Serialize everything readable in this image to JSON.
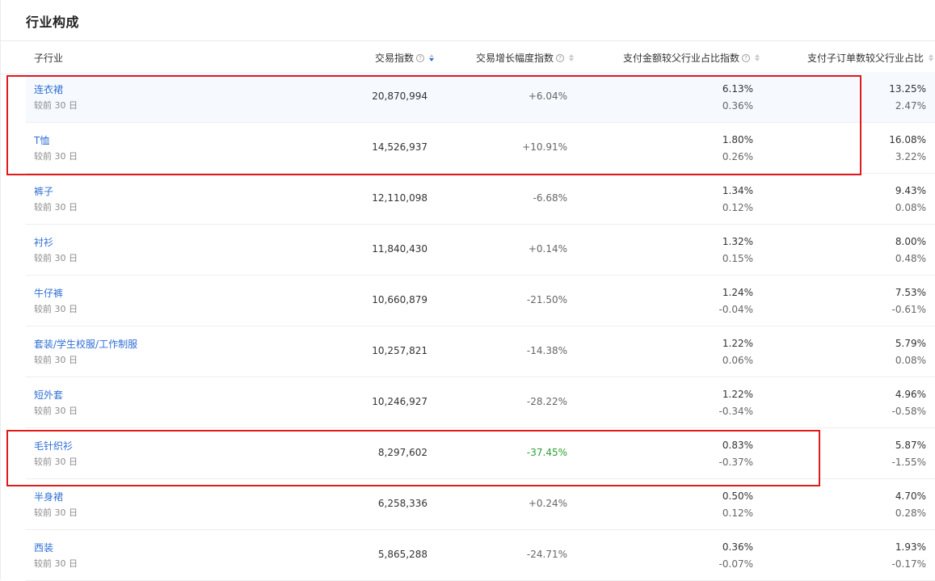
{
  "title": "行业构成",
  "headers": {
    "sub_industry": "子行业",
    "trade_index": "交易指数",
    "growth_index": "交易增长幅度指数",
    "pay_share": "支付金额较父行业占比指数",
    "order_share": "支付子订单数较父行业占比"
  },
  "compare_label": "较前 30 日",
  "rows": [
    {
      "name": "连衣裙",
      "compare": "较前 30 日",
      "trade": "20,870,994",
      "growth": "+6.04%",
      "pay": "6.13%",
      "pay_change": "0.36%",
      "order": "13.25%",
      "order_change": "2.47%"
    },
    {
      "name": "T恤",
      "compare": "较前 30 日",
      "trade": "14,526,937",
      "growth": "+10.91%",
      "pay": "1.80%",
      "pay_change": "0.26%",
      "order": "16.08%",
      "order_change": "3.22%"
    },
    {
      "name": "裤子",
      "compare": "较前 30 日",
      "trade": "12,110,098",
      "growth": "-6.68%",
      "pay": "1.34%",
      "pay_change": "0.12%",
      "order": "9.43%",
      "order_change": "0.08%"
    },
    {
      "name": "衬衫",
      "compare": "较前 30 日",
      "trade": "11,840,430",
      "growth": "+0.14%",
      "pay": "1.32%",
      "pay_change": "0.15%",
      "order": "8.00%",
      "order_change": "0.48%"
    },
    {
      "name": "牛仔裤",
      "compare": "较前 30 日",
      "trade": "10,660,879",
      "growth": "-21.50%",
      "pay": "1.24%",
      "pay_change": "-0.04%",
      "order": "7.53%",
      "order_change": "-0.61%"
    },
    {
      "name": "套装/学生校服/工作制服",
      "compare": "较前 30 日",
      "trade": "10,257,821",
      "growth": "-14.38%",
      "pay": "1.22%",
      "pay_change": "0.06%",
      "order": "5.79%",
      "order_change": "0.08%"
    },
    {
      "name": "短外套",
      "compare": "较前 30 日",
      "trade": "10,246,927",
      "growth": "-28.22%",
      "pay": "1.22%",
      "pay_change": "-0.34%",
      "order": "4.96%",
      "order_change": "-0.58%"
    },
    {
      "name": "毛针织衫",
      "compare": "较前 30 日",
      "trade": "8,297,602",
      "growth": "-37.45%",
      "pay": "0.83%",
      "pay_change": "-0.37%",
      "order": "5.87%",
      "order_change": "-1.55%"
    },
    {
      "name": "半身裙",
      "compare": "较前 30 日",
      "trade": "6,258,336",
      "growth": "+0.24%",
      "pay": "0.50%",
      "pay_change": "0.12%",
      "order": "4.70%",
      "order_change": "0.28%"
    },
    {
      "name": "西装",
      "compare": "较前 30 日",
      "trade": "5,865,288",
      "growth": "-24.71%",
      "pay": "0.36%",
      "pay_change": "-0.07%",
      "order": "1.93%",
      "order_change": "-0.17%"
    }
  ],
  "colors": {
    "link": "#2f6fd4",
    "highlight_green": "#2aa234",
    "annotation_red": "#e01a1a",
    "row_highlight": "#f6f9fe"
  }
}
